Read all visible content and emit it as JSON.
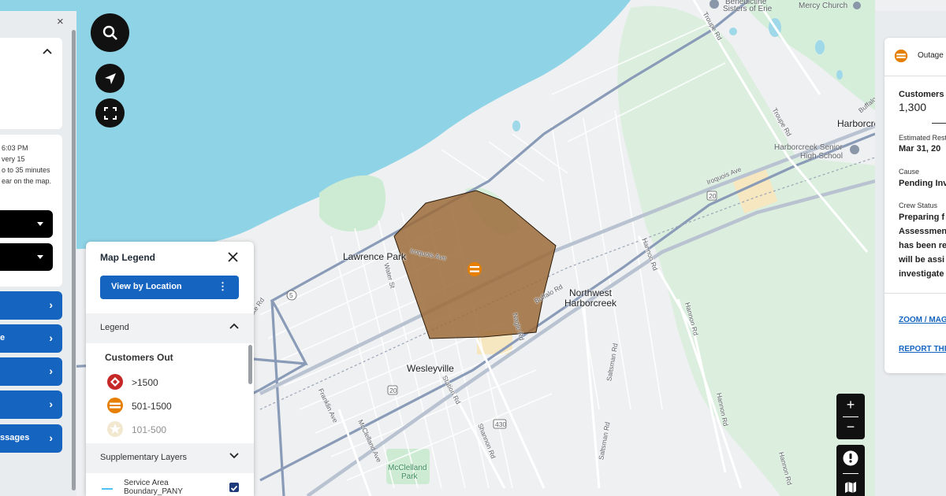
{
  "map": {
    "places": {
      "lawrence_park": "Lawrence Park",
      "northwest_harborcreek_1": "Northwest",
      "northwest_harborcreek_2": "Harborcreek",
      "wesleyville": "Wesleyville",
      "harborcreek": "Harborcreek",
      "mccleland_park_1": "McClelland",
      "mccleland_park_2": "Park"
    },
    "pois": {
      "benedictine_1": "Benedictine",
      "benedictine_2": "Sisters of Erie",
      "mercy_church": "Mercy Church",
      "harborcreek_hs_1": "Harborcreek Senior",
      "harborcreek_hs_2": "High School"
    },
    "roads": {
      "iroquois_ave_1": "Iroquois Ave",
      "iroquois_ave_2": "Iroquois Ave",
      "buffalo_rd_1": "Buffalo Rd",
      "buffalo_rd_2": "Buffalo",
      "troupe_rd_1": "Troupe Rd",
      "troupe_rd_2": "Troupe Rd",
      "water_st": "Water St",
      "station_rd": "Station Rd",
      "franklin_ave": "Franklin Ave",
      "mcclelland_ave": "McClelland Ave",
      "shannon_rd": "Shannon Rd",
      "saltsman_rd_1": "Saltsman Rd",
      "saltsman_rd_2": "Saltsman Rd",
      "hannon_rd_1": "Hannon Rd",
      "hannon_rd_2": "Hannon Rd",
      "hannon_rd_3": "Hannon Rd",
      "hannon_rd_4": "Hannon Rd",
      "nagle_rd": "Nagle Rd",
      "lake_rd": "ake Rd",
      "route_5": "5",
      "route_20_a": "20",
      "route_20_b": "20",
      "route_430": "430"
    }
  },
  "left_panel": {
    "close_icon": "×",
    "info_lines": [
      "6:03 PM",
      "very 15",
      "o to 35 minutes",
      "ear on the map."
    ],
    "nav_buttons": [
      "",
      "e",
      "",
      "",
      "ssages"
    ]
  },
  "legend": {
    "title": "Map Legend",
    "view_button": "View by Location",
    "legend_section": "Legend",
    "customers_out": "Customers Out",
    "items": [
      {
        "label": ">1500",
        "icon": "diamond-red-icon",
        "color": "#c62828"
      },
      {
        "label": "501-1500",
        "icon": "circle-orange-equals-icon",
        "color": "#e67e00"
      },
      {
        "label": "101-500",
        "icon": "star-tan-icon",
        "color": "#e8d7a8"
      }
    ],
    "supplementary_layers": "Supplementary Layers",
    "layer_1": "Service Area",
    "layer_2": "Boundary_PANY"
  },
  "outage_panel": {
    "title": "Outage",
    "customers_label": "Customers O",
    "customers_value": "1,300",
    "restoration_label": "Estimated Rest",
    "restoration_value": "Mar 31, 20",
    "cause_label": "Cause",
    "cause_value": "Pending Inv",
    "crew_label": "Crew Status",
    "crew_lines": [
      "Preparing f",
      "Assessmen",
      "has been re",
      "will be assi",
      "investigate"
    ],
    "zoom_link": "ZOOM / MAG",
    "report_link": "REPORT THI"
  },
  "colors": {
    "water": "#8fd3e6",
    "land": "#f1f3f4",
    "park": "#cdebd3",
    "outage_polygon": "#9c6b3a",
    "accent": "#1565c0"
  }
}
